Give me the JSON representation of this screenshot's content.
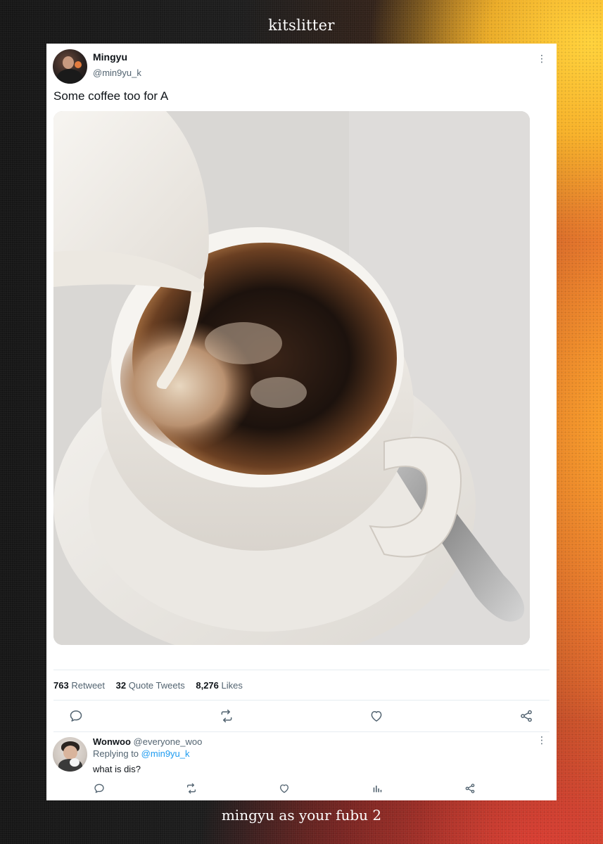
{
  "watermark_top": "kitslitter",
  "caption_bottom": "mingyu as your fubu 2",
  "tweet": {
    "author_name": "Mingyu",
    "author_handle": "@min9yu_k",
    "text": "Some coffee too for A",
    "more_icon": "⋮",
    "stats": {
      "retweets_count": "763",
      "retweets_label": "Retweet",
      "quotes_count": "32",
      "quotes_label": "Quote Tweets",
      "likes_count": "8,276",
      "likes_label": "Likes"
    },
    "actions": [
      "reply-icon",
      "retweet-icon",
      "like-icon",
      "share-icon"
    ]
  },
  "reply": {
    "author_name": "Wonwoo",
    "author_handle": "@everyone_woo",
    "replying_prefix": "Replying to",
    "replying_to": "@min9yu_k",
    "text": "what is dis?",
    "more_icon": "⋮",
    "actions": [
      "reply-icon",
      "retweet-icon",
      "like-icon",
      "analytics-icon",
      "share-icon"
    ]
  },
  "colors": {
    "icon_gray": "#536471",
    "link_blue": "#1d9bf0",
    "text_dark": "#0f1419"
  }
}
